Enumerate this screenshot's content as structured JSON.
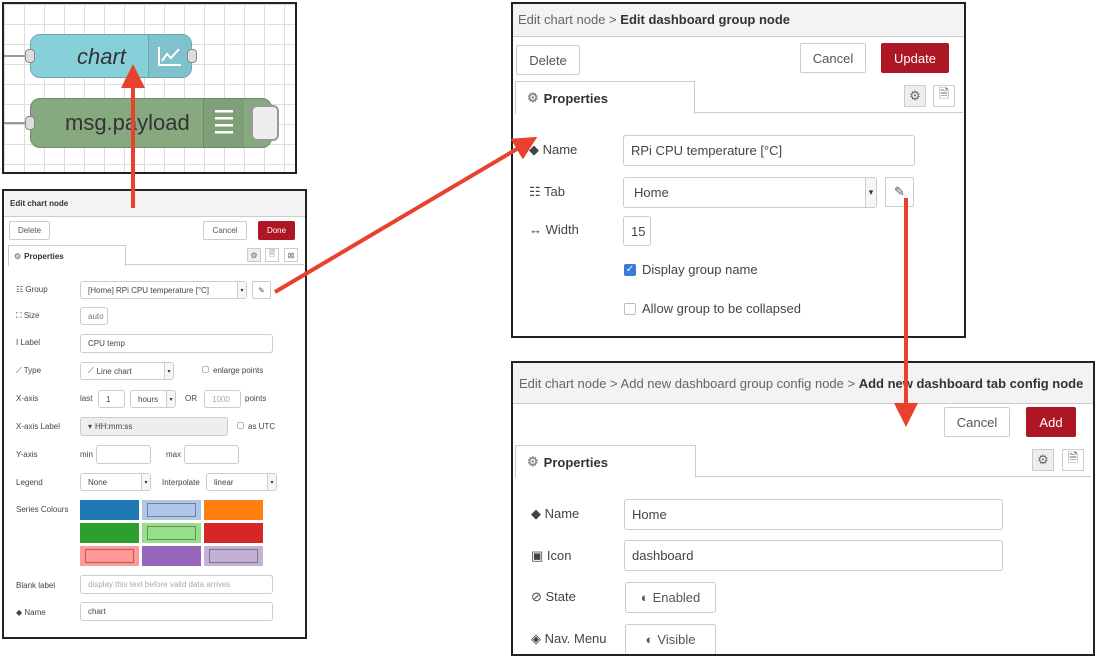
{
  "flow": {
    "chart_node_label": "chart",
    "debug_node_label": "msg.payload"
  },
  "chart_editor": {
    "header": "Edit chart node",
    "delete_label": "Delete",
    "cancel_label": "Cancel",
    "done_label": "Done",
    "properties_tab": "Properties",
    "group_label": "Group",
    "group_value": "[Home] RPi CPU temperature [°C]",
    "size_label": "Size",
    "size_value": "auto",
    "label_label": "Label",
    "label_value": "CPU temp",
    "type_label": "Type",
    "type_value": "Line chart",
    "enlarge_points_label": "enlarge points",
    "xaxis_label": "X-axis",
    "last_label": "last",
    "last_value": "1",
    "hours_value": "hours",
    "or_label": "OR",
    "points_placeholder": "1000",
    "points_label": "points",
    "xaxis_label_label": "X-axis Label",
    "xaxis_label_value": "HH:mm:ss",
    "as_utc_label": "as UTC",
    "yaxis_label": "Y-axis",
    "min_label": "min",
    "max_label": "max",
    "legend_label": "Legend",
    "legend_value": "None",
    "interpolate_label": "Interpolate",
    "interpolate_value": "linear",
    "series_colours_label": "Series Colours",
    "series_colours": [
      "#1f77b4",
      "#aec7e8",
      "#ff7f0e",
      "#2ca02c",
      "#98df8a",
      "#d62728",
      "#ff9896",
      "#9467bd",
      "#c5b0d5"
    ],
    "blank_label_label": "Blank label",
    "blank_label_placeholder": "display this text before valid data arrives",
    "name_label": "Name",
    "name_value": "chart"
  },
  "group_editor": {
    "breadcrumb": "Edit chart node >",
    "title": "Edit dashboard group node",
    "delete_label": "Delete",
    "cancel_label": "Cancel",
    "update_label": "Update",
    "properties_tab": "Properties",
    "name_label": "Name",
    "name_value": "RPi CPU temperature [°C]",
    "tab_label": "Tab",
    "tab_value": "Home",
    "width_label": "Width",
    "width_value": "15",
    "display_group_name_label": "Display group name",
    "display_group_name_checked": true,
    "allow_collapse_label": "Allow group to be collapsed",
    "allow_collapse_checked": false
  },
  "tab_editor": {
    "breadcrumb": "Edit chart node > Add new dashboard group config node >",
    "title": "Add new dashboard tab config node",
    "cancel_label": "Cancel",
    "add_label": "Add",
    "properties_tab": "Properties",
    "name_label": "Name",
    "name_value": "Home",
    "icon_label": "Icon",
    "icon_value": "dashboard",
    "state_label": "State",
    "state_value": "Enabled",
    "nav_menu_label": "Nav. Menu",
    "nav_menu_value": "Visible"
  },
  "colors": {
    "accent_red": "#ad1625",
    "arrow_red": "#e8412e",
    "chart_node": "#87cfd9",
    "debug_node": "#87a980"
  },
  "icons": [
    "cog-icon",
    "file-icon",
    "tag-icon",
    "table-icon",
    "arrows-h-icon",
    "picture-icon",
    "ban-icon",
    "eye-slash-icon",
    "toggle-icon",
    "pencil-icon",
    "caret-down-icon",
    "line-chart-icon",
    "list-icon",
    "checkbox-icon"
  ]
}
